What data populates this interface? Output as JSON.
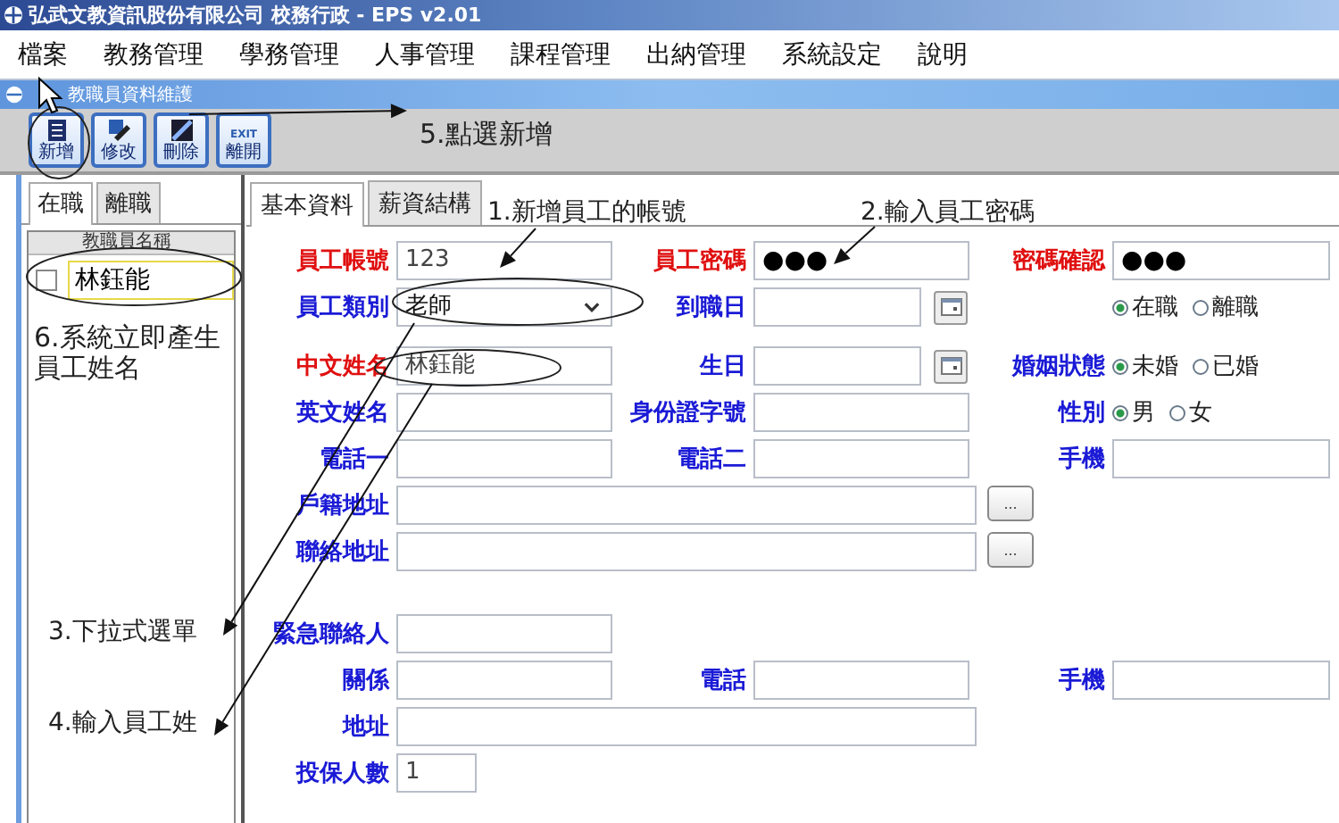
{
  "window": {
    "title": "弘武文教資訊股份有限公司 校務行政 - EPS v2.01"
  },
  "menu": [
    "檔案",
    "教務管理",
    "學務管理",
    "人事管理",
    "課程管理",
    "出納管理",
    "系統設定",
    "說明"
  ],
  "subwindow": {
    "title": "教職員資料維護"
  },
  "toolbar": [
    {
      "kind": "new",
      "label": "新增"
    },
    {
      "kind": "edit",
      "label": "修改"
    },
    {
      "kind": "delete",
      "label": "刪除"
    },
    {
      "kind": "exit",
      "label": "離開",
      "badge": "EXIT"
    }
  ],
  "sidebar": {
    "tabs": [
      {
        "label": "在職",
        "selected": true
      },
      {
        "label": "離職",
        "selected": false
      }
    ],
    "column": "教職員名稱",
    "rows": [
      {
        "name": "林鈺能",
        "checked": false
      }
    ]
  },
  "form": {
    "tabs": [
      {
        "label": "基本資料",
        "selected": true
      },
      {
        "label": "薪資結構",
        "selected": false
      }
    ],
    "sections": [
      [
        [
          {
            "label": "員工帳號",
            "required": true,
            "kind": "text",
            "value": "123"
          },
          {
            "label": "員工密碼",
            "required": true,
            "kind": "password",
            "value": "●●●"
          },
          {
            "label": "密碼確認",
            "required": true,
            "kind": "password",
            "value": "●●●"
          }
        ],
        [
          {
            "label": "員工類別",
            "required": false,
            "kind": "select",
            "value": "老師"
          },
          {
            "label": "到職日",
            "required": false,
            "kind": "date"
          },
          {
            "kind": "radio",
            "options": [
              {
                "label": "在職",
                "selected": true
              },
              {
                "label": "離職",
                "selected": false
              }
            ]
          }
        ]
      ],
      [
        [
          {
            "label": "中文姓名",
            "required": true,
            "kind": "text",
            "value": "林鈺能"
          },
          {
            "label": "生日",
            "required": false,
            "kind": "date"
          },
          {
            "label": "婚姻狀態",
            "required": false,
            "kind": "radio",
            "options": [
              {
                "label": "未婚",
                "selected": true
              },
              {
                "label": "已婚",
                "selected": false
              }
            ]
          }
        ],
        [
          {
            "label": "英文姓名",
            "required": false,
            "kind": "text"
          },
          {
            "label": "身份證字號",
            "required": false,
            "kind": "text"
          },
          {
            "label": "性別",
            "required": false,
            "kind": "radio",
            "options": [
              {
                "label": "男",
                "selected": true
              },
              {
                "label": "女",
                "selected": false
              }
            ]
          }
        ],
        [
          {
            "label": "電話一",
            "required": false,
            "kind": "text"
          },
          {
            "label": "電話二",
            "required": false,
            "kind": "text"
          },
          {
            "label": "手機",
            "required": false,
            "kind": "text"
          }
        ],
        [
          {
            "label": "戶籍地址",
            "required": false,
            "kind": "address",
            "button": "..."
          }
        ],
        [
          {
            "label": "聯絡地址",
            "required": false,
            "kind": "address",
            "button": "..."
          }
        ]
      ],
      [
        [
          {
            "label": "緊急聯絡人",
            "required": false,
            "kind": "text"
          }
        ],
        [
          {
            "label": "關係",
            "required": false,
            "kind": "text"
          },
          {
            "label": "電話",
            "required": false,
            "kind": "text"
          },
          {
            "label": "手機",
            "required": false,
            "kind": "text"
          }
        ],
        [
          {
            "label": "地址",
            "required": false,
            "kind": "address"
          }
        ],
        [
          {
            "label": "投保人數",
            "required": false,
            "kind": "number",
            "value": "1"
          }
        ]
      ]
    ]
  },
  "annotations": [
    {
      "text": "1.新增員工的帳號"
    },
    {
      "text": "2.輸入員工密碼"
    },
    {
      "text": "3.下拉式選單"
    },
    {
      "text": "4.輸入員工姓"
    },
    {
      "text": "5.點選新增"
    },
    {
      "text": "6.系統立即產生員工姓名"
    }
  ]
}
